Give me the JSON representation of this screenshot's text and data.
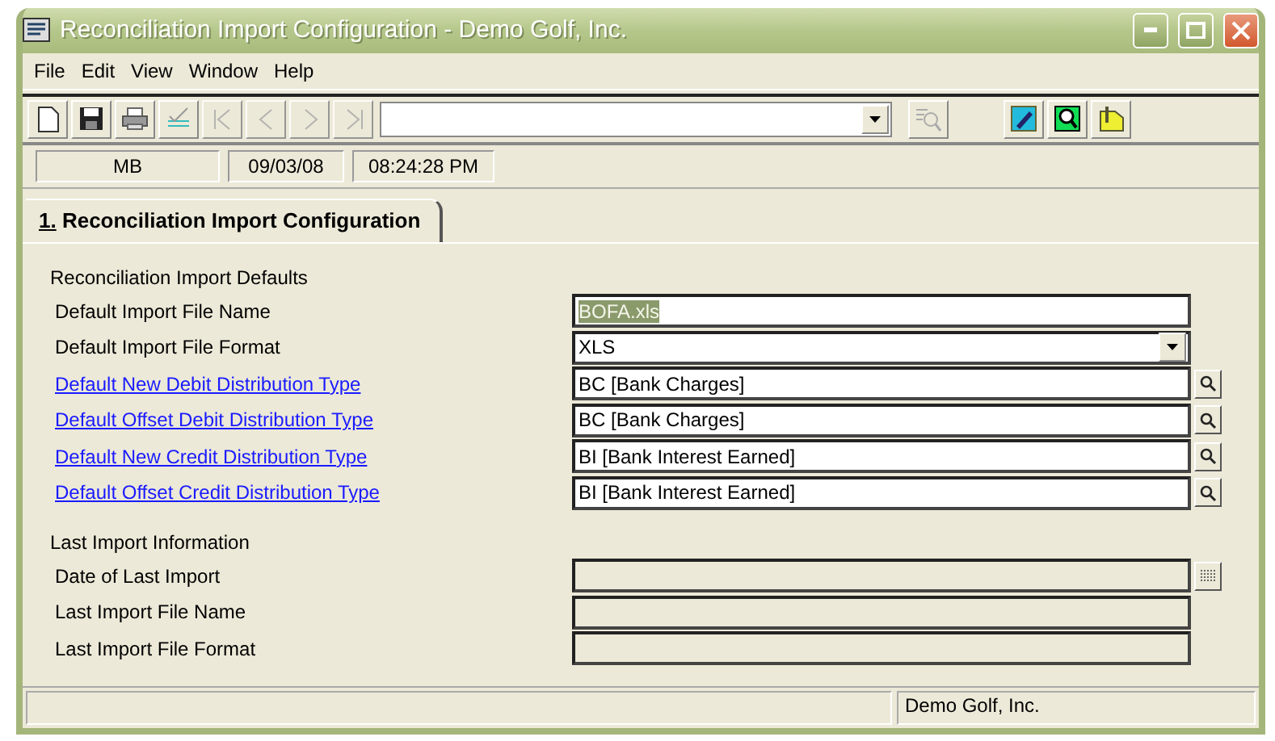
{
  "window": {
    "title": "Reconciliation Import Configuration - Demo Golf, Inc."
  },
  "menu": [
    "File",
    "Edit",
    "View",
    "Window",
    "Help"
  ],
  "toolbar": {
    "buttons": [
      {
        "kind": "new",
        "disabled": false
      },
      {
        "kind": "save",
        "disabled": false
      },
      {
        "kind": "print",
        "disabled": false
      },
      {
        "kind": "approve",
        "disabled": false
      },
      {
        "kind": "first",
        "disabled": true
      },
      {
        "kind": "prev",
        "disabled": true
      },
      {
        "kind": "next",
        "disabled": true
      },
      {
        "kind": "last",
        "disabled": true
      }
    ],
    "find_button": {
      "disabled": true
    },
    "extra_buttons": [
      {
        "kind": "edit"
      },
      {
        "kind": "preview"
      },
      {
        "kind": "notes"
      }
    ]
  },
  "info_bar": [
    "MB",
    "09/03/08",
    "08:24:28 PM"
  ],
  "tabs": [
    {
      "label": "1. Reconciliation Import Configuration",
      "selected": true
    }
  ],
  "sections": [
    {
      "heading": "Reconciliation Import Defaults",
      "fields": [
        {
          "label": "Default Import File Name",
          "link": false,
          "kind": "text",
          "value": "BOFA.xls",
          "highlighted": true,
          "disabled": false
        },
        {
          "label": "Default Import File Format",
          "link": false,
          "kind": "select",
          "value": "XLS",
          "disabled": false
        },
        {
          "label": "Default New Debit Distribution Type",
          "link": true,
          "kind": "lookup",
          "value": "BC [Bank Charges]",
          "disabled": false
        },
        {
          "label": "Default Offset Debit Distribution Type",
          "link": true,
          "kind": "lookup",
          "value": "BC [Bank Charges]",
          "disabled": false
        },
        {
          "label": "Default New Credit Distribution Type",
          "link": true,
          "kind": "lookup",
          "value": "BI [Bank Interest Earned]",
          "disabled": false
        },
        {
          "label": "Default Offset Credit Distribution Type",
          "link": true,
          "kind": "lookup",
          "value": "BI [Bank Interest Earned]",
          "disabled": false
        }
      ]
    },
    {
      "heading": "Last Import Information",
      "fields": [
        {
          "label": "Date of Last Import",
          "link": false,
          "kind": "date",
          "disabled": true
        },
        {
          "label": "Last Import File Name",
          "link": false,
          "kind": "text",
          "disabled": true
        },
        {
          "label": "Last Import File Format",
          "link": false,
          "kind": "text",
          "disabled": true
        }
      ]
    }
  ],
  "status_bar": {
    "company": "Demo Golf, Inc."
  }
}
